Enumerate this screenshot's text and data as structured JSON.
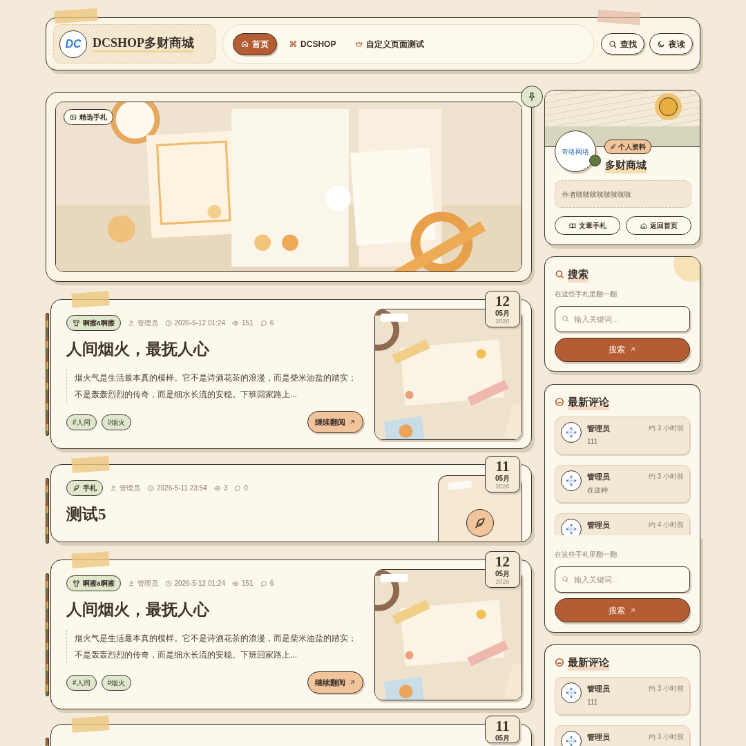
{
  "header": {
    "logo": "DC",
    "site_name": "DCSHOP多财商城",
    "nav": [
      {
        "label": "首页",
        "selected": true
      },
      {
        "label": "DCSHOP",
        "selected": false
      },
      {
        "label": "自定义页面测试",
        "selected": false
      }
    ],
    "actions": [
      "查找",
      "夜读"
    ]
  },
  "hero": {
    "badge": "精选手札"
  },
  "posts": [
    {
      "kind": "full",
      "category": "啊擦a啊擦",
      "author": "管理员",
      "date": "2026-5-12 01:24",
      "views": "151",
      "comments": "6",
      "title": "人间烟火，最抚人心",
      "excerpt": "烟火气是生活最本真的模样。它不是诗酒花茶的浪漫，而是柴米油盐的踏实；不是轰轰烈烈的传奇，而是细水长流的安稳。下班回家路上...",
      "tags": [
        "#人间",
        "#烟火"
      ],
      "button": "继续翻阅",
      "day": "12",
      "month": "05月",
      "year": "2026"
    },
    {
      "kind": "short",
      "category": "手札",
      "author": "管理员",
      "date": "2026-5-11 23:54",
      "views": "3",
      "comments": "0",
      "title": "测试5",
      "day": "11",
      "month": "05月",
      "year": "2026"
    },
    {
      "kind": "full",
      "category": "啊擦a啊擦",
      "author": "管理员",
      "date": "2026-5-12 01:24",
      "views": "151",
      "comments": "6",
      "title": "人间烟火，最抚人心",
      "excerpt": "烟火气是生活最本真的模样。它不是诗酒花茶的浪漫，而是柴米油盐的踏实；不是轰轰烈烈的传奇，而是细水长流的安稳。下班回家路上...",
      "tags": [
        "#人间",
        "#烟火"
      ],
      "button": "继续翻阅",
      "day": "12",
      "month": "05月",
      "year": "2026"
    },
    {
      "kind": "cut",
      "day": "11",
      "month": "05月"
    }
  ],
  "sidebar": {
    "profile": {
      "avatar_label": "奇络网络",
      "online": true,
      "badge": "个人资料",
      "name": "多财商城",
      "bio": "作者吱吱吱吱吱吱吱吱",
      "buttons": [
        "文章手札",
        "返回首页"
      ]
    },
    "widgets": [
      {
        "kind": "search",
        "title": "搜索",
        "subtitle": "在这些手札里翻一翻",
        "placeholder": "输入关键词...",
        "button": "搜索"
      },
      {
        "kind": "comments",
        "title": "最新评论",
        "items": [
          {
            "name": "管理员",
            "time": "约 3 小时前",
            "text": "111"
          },
          {
            "name": "管理员",
            "time": "约 3 小时前",
            "text": "在这种"
          },
          {
            "name": "管理员",
            "time": "约 4 小时前"
          }
        ]
      },
      {
        "kind": "search",
        "subtitle": "在这些手札里翻一翻",
        "placeholder": "输入关键词...",
        "button": "搜索"
      },
      {
        "kind": "comments",
        "title": "最新评论",
        "items": [
          {
            "name": "管理员",
            "time": "约 3 小时前",
            "text": "111"
          },
          {
            "name": "管理员",
            "time": "约 3 小时前"
          }
        ]
      }
    ]
  }
}
